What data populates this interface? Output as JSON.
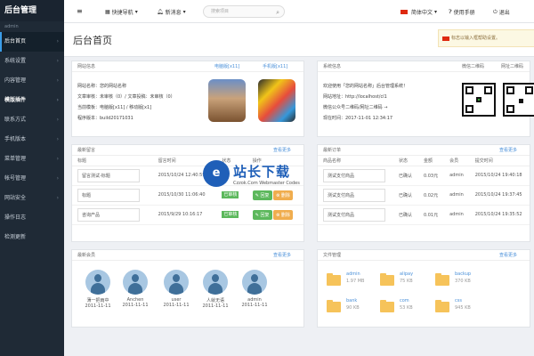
{
  "sidebar": {
    "logo": "后台管理",
    "admin_label": "admin",
    "items": [
      {
        "label": "后台首页",
        "active": true
      },
      {
        "label": "系统设置"
      },
      {
        "label": "内容管理"
      },
      {
        "label": "模版插件",
        "highlight": true
      },
      {
        "label": "联系方式"
      },
      {
        "label": "手机版本"
      },
      {
        "label": "菜单管理"
      },
      {
        "label": "帐号管理"
      },
      {
        "label": "网站安全"
      },
      {
        "label": "操作日志"
      },
      {
        "label": "检测更新"
      }
    ]
  },
  "topbar": {
    "menu_icon": "≡",
    "quick_nav": "快捷导航",
    "new_msg": "新消息",
    "search_placeholder": "搜索项目",
    "lang": "简体中文",
    "manual": "使用手册",
    "logout": "退出"
  },
  "page": {
    "title": "后台首页",
    "notice": "标志以输入框帮助设置。"
  },
  "site_info": {
    "title": "网站信息",
    "link1": "电脑版[x11]",
    "link2": "手机版[x11]",
    "lines": [
      "网站名称：您的网站名称",
      "文章审核：未审核（0）/ 文章投稿：未审核（0）",
      "当前模板：电脑版[x11] / 移动版[x1]",
      "程序版本：build20171031"
    ]
  },
  "sys_info": {
    "title": "系统信息",
    "qr1": "微信二维码",
    "qr2": "网址二维码",
    "lines": [
      "欢迎使用「您的网站名称」后台管理系统！",
      "网站地址：http://localhost/cl1",
      "微信公众号二维码/网址二维码 →",
      "现在时间：2017-11-01 12:34:17"
    ]
  },
  "messages": {
    "title": "最新留言",
    "more": "查看更多",
    "headers": [
      "标题",
      "留言时间",
      "状态",
      "操作"
    ],
    "rows": [
      {
        "title": "留言测试-标题",
        "time": "2015/10/24 12:40:59",
        "status": "",
        "op1": "",
        "op2": ""
      },
      {
        "title": "标题",
        "time": "2015/10/30 11:06:40",
        "status": "已审核",
        "op1": "回复",
        "op2": "删除"
      },
      {
        "title": "咨询产品",
        "time": "2015/9/29 10:16:17",
        "status": "已审核",
        "op1": "回复",
        "op2": "删除"
      }
    ]
  },
  "orders": {
    "title": "最新订单",
    "more": "查看更多",
    "headers": [
      "商品名称",
      "状态",
      "金额",
      "会员",
      "提交时间"
    ],
    "rows": [
      {
        "name": "测试支付商品",
        "status": "已确认",
        "amount": "0.03元",
        "member": "admin",
        "time": "2015/10/24 19:40:18"
      },
      {
        "name": "测试支付商品",
        "status": "已确认",
        "amount": "0.02元",
        "member": "admin",
        "time": "2015/10/24 19:37:45"
      },
      {
        "name": "测试支付商品",
        "status": "已确认",
        "amount": "0.01元",
        "member": "admin",
        "time": "2015/10/24 19:35:52"
      }
    ]
  },
  "members": {
    "title": "最新会员",
    "more": "查看更多",
    "list": [
      {
        "name": "薄一把雨中",
        "date": "2011-11-11"
      },
      {
        "name": "Anchen",
        "date": "2011-11-11"
      },
      {
        "name": "user",
        "date": "2011-11-11"
      },
      {
        "name": "人就无语",
        "date": "2011-11-11"
      },
      {
        "name": "admin",
        "date": "2011-11-11"
      }
    ]
  },
  "files": {
    "title": "文件管理",
    "more": "查看更多",
    "list": [
      {
        "name": "admin",
        "size": "1.97 MB"
      },
      {
        "name": "alipay",
        "size": "75 KB"
      },
      {
        "name": "backup",
        "size": "370 KB"
      },
      {
        "name": "bank",
        "size": "90 KB"
      },
      {
        "name": "com",
        "size": "53 KB"
      },
      {
        "name": "css",
        "size": "945 KB"
      }
    ]
  },
  "watermark": {
    "logo": "e",
    "title": "站长下载",
    "sub": "Czzok.Com Webmaster Codes"
  },
  "colors": {
    "sidebar": "#1f2a36",
    "accent": "#3b9de8",
    "link": "#4a90d9",
    "success": "#5cb85c",
    "warning": "#f0ad4e"
  }
}
